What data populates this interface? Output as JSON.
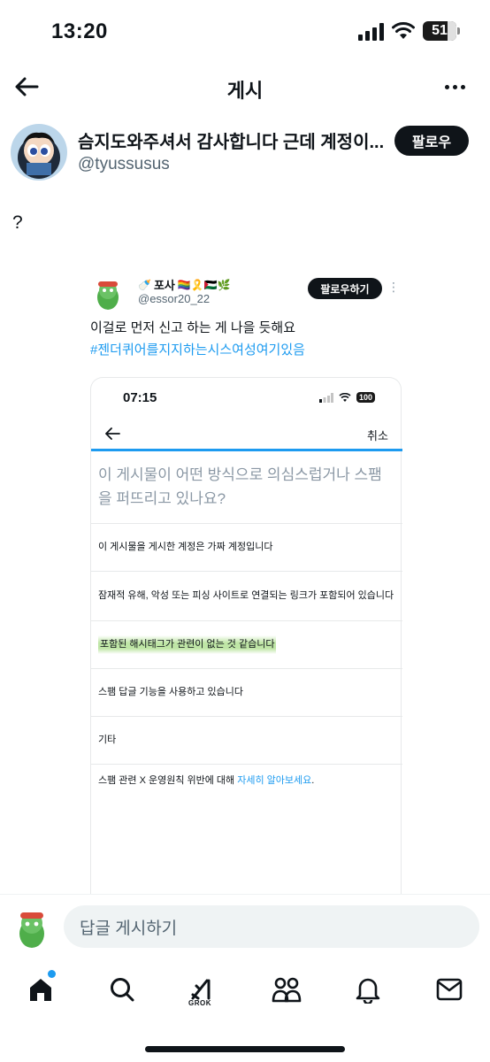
{
  "status_bar": {
    "time": "13:20",
    "battery": "51"
  },
  "header": {
    "title": "게시"
  },
  "post": {
    "author_name": "슴지도와주셔서 감사합니다 근데 계정이...",
    "author_handle": "@tyussusus",
    "follow_label": "팔로우",
    "text": "?"
  },
  "embedded_tweet": {
    "name": "포사",
    "name_emojis": "🏳️‍🌈🎗️🇵🇸🌿",
    "handle": "@essor20_22",
    "follow_label": "팔로우하기",
    "text": "이걸로 먼저 신고 하는 게 나을 듯해요",
    "hashtag": "#젠더퀴어를지지하는시스여성여기있음",
    "screenshot": {
      "time": "07:15",
      "battery": "100",
      "cancel_label": "취소",
      "question": "이 게시물이 어떤 방식으로 의심스럽거나 스팸을 퍼뜨리고 있나요?",
      "options": [
        "이 게시물을 게시한 계정은 가짜 계정입니다",
        "잠재적 유해, 악성 또는 피싱 사이트로 연결되는 링크가 포함되어 있습니다",
        "포함된 해시태그가 관련이 없는 것 같습니다",
        "스팸 답글 기능을 사용하고 있습니다",
        "기타"
      ],
      "footer_text": "스팸 관련 X 운영원칙 위반에 대해 ",
      "footer_link": "자세히 알아보세요",
      "footer_end": "."
    }
  },
  "reply": {
    "placeholder": "답글 게시하기"
  },
  "tab_bar": {
    "grok_label": "GROK"
  },
  "colors": {
    "accent": "#1d9bf0",
    "text": "#0f1419",
    "secondary": "#536471"
  }
}
